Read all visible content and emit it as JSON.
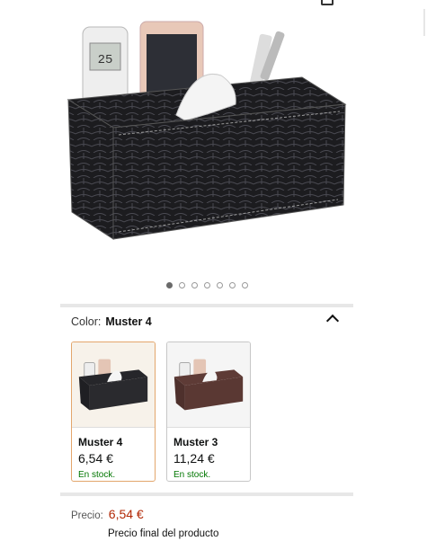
{
  "gallery": {
    "image_alt": "Black crocodile leather tissue box organizer with remote control and phone",
    "dots_total": 7,
    "active_dot": 0,
    "remote_display": "25"
  },
  "variation": {
    "color_label": "Color:",
    "selected_value": "Muster 4",
    "options": [
      {
        "name": "Muster 4",
        "price": "6,54 €",
        "stock": "En stock.",
        "selected": true
      },
      {
        "name": "Muster 3",
        "price": "11,24 €",
        "stock": "En stock.",
        "selected": false
      }
    ]
  },
  "pricing": {
    "label": "Precio:",
    "value": "6,54 €",
    "note": "Precio final del producto"
  },
  "colors": {
    "price": "#b12704",
    "stock": "#007600",
    "selected_border": "#e3a66c"
  }
}
